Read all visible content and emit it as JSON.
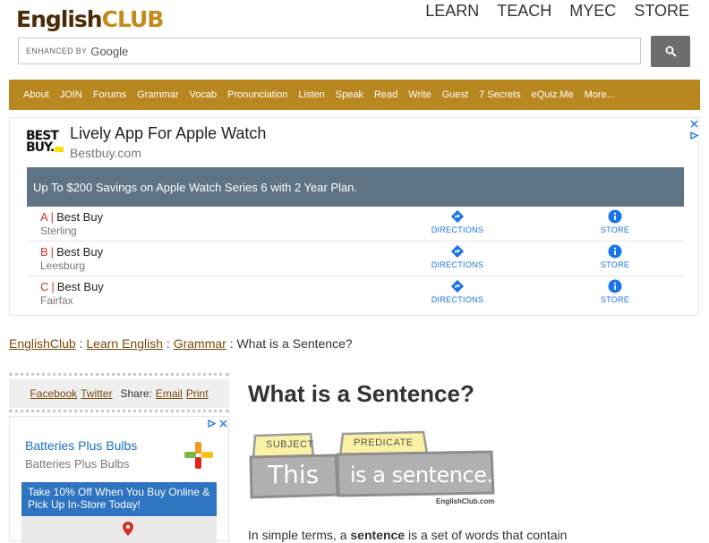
{
  "header": {
    "logo_part1": "English",
    "logo_part2": "CLUB",
    "topnav": [
      "LEARN",
      "TEACH",
      "MYEC",
      "STORE"
    ]
  },
  "search": {
    "enhanced_label": "ENHANCED BY",
    "provider": "Google"
  },
  "mainnav": [
    "About",
    "JOIN",
    "Forums",
    "Grammar",
    "Vocab",
    "Pronunciation",
    "Listen",
    "Speak",
    "Read",
    "Write",
    "Guest",
    "7 Secrets",
    "eQuiz.Me",
    "More..."
  ],
  "ad1": {
    "logo_line1": "BEST",
    "logo_line2": "BUY.",
    "title": "Lively App For Apple Watch",
    "subtitle": "Bestbuy.com",
    "promo": "Up To $200 Savings on Apple Watch Series 6 with 2 Year Plan.",
    "locations": [
      {
        "letter": "A",
        "name": "Best Buy",
        "city": "Sterling"
      },
      {
        "letter": "B",
        "name": "Best Buy",
        "city": "Leesburg"
      },
      {
        "letter": "C",
        "name": "Best Buy",
        "city": "Fairfax"
      }
    ],
    "directions_label": "DIRECTIONS",
    "store_label": "STORE"
  },
  "breadcrumb": {
    "items": [
      "EnglishClub",
      "Learn English",
      "Grammar"
    ],
    "separator": ":",
    "current": "What is a Sentence?"
  },
  "share": {
    "facebook": "Facebook",
    "twitter": "Twitter",
    "share_label": "Share:",
    "email": "Email",
    "print": "Print"
  },
  "ad2": {
    "title": "Batteries Plus Bulbs",
    "subtitle": "Batteries Plus Bulbs",
    "promo": "Take 10% Off When You Buy Online & Pick Up In-Store Today!"
  },
  "article": {
    "title": "What is a Sentence?",
    "diagram": {
      "subject_label": "SUBJECT",
      "predicate_label": "PREDICATE",
      "subject_text": "This",
      "predicate_text": "is a sentence.",
      "credit": "EnglishClub.com"
    },
    "intro_pre": "In simple terms, a ",
    "intro_bold": "sentence",
    "intro_post": " is a set of words that contain"
  },
  "colors": {
    "nav_brown": "#b9871f",
    "link_brown": "#7a4a0a",
    "ad_blue": "#1a73e8",
    "promo_slate": "#5e7384"
  }
}
